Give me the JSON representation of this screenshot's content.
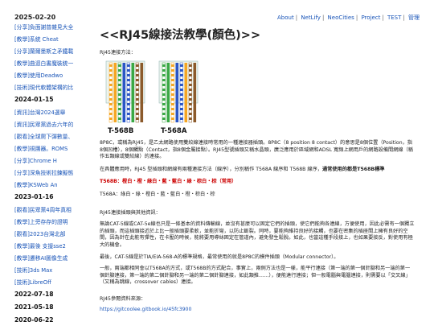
{
  "header": {
    "date": "2025-02-20",
    "nav": [
      "About",
      "NetLify",
      "NeoCities",
      "Project",
      "TEST",
      "管理"
    ]
  },
  "sidebar": {
    "items": [
      {
        "kind": "link",
        "text": "[分享]負面謝普雜見大全"
      },
      {
        "kind": "link",
        "text": "[教學]系統 Cheat"
      },
      {
        "kind": "link",
        "text": "[分享]蘭爾墨斯之矛鐵載"
      },
      {
        "kind": "link",
        "text": "[教學]曲迴白書魔裝統一"
      },
      {
        "kind": "link",
        "text": "[教學]使用Deadwo"
      },
      {
        "kind": "link",
        "text": "[技術]現代軟體架構的比"
      },
      {
        "kind": "date",
        "text": "2024-01-15"
      },
      {
        "kind": "link",
        "text": "[資訊]台灣2024選舉"
      },
      {
        "kind": "link",
        "text": "[資訊]民眾黨過去六年的"
      },
      {
        "kind": "link",
        "text": "[觀看]全球爬下彈數量、"
      },
      {
        "kind": "link",
        "text": "[教學]視團器。ROMS"
      },
      {
        "kind": "link",
        "text": "[分享]Chrome H"
      },
      {
        "kind": "link",
        "text": "[分享]深魚技術拉鍊擬態"
      },
      {
        "kind": "link",
        "text": "[教學]KSWeb An"
      },
      {
        "kind": "date",
        "text": "2023-01-16"
      },
      {
        "kind": "link",
        "text": "[觀看]民眾黨4周年真相"
      },
      {
        "kind": "link",
        "text": "[教學]上旁存存的證明"
      },
      {
        "kind": "link",
        "text": "[觀看]2023台灣北部"
      },
      {
        "kind": "link",
        "text": "[教學]最後 支援sse2"
      },
      {
        "kind": "link",
        "text": "[教學]遷移AI圖像生成"
      },
      {
        "kind": "link",
        "text": "[技術]3ds Max"
      },
      {
        "kind": "link",
        "text": "[技術]LibreOff"
      },
      {
        "kind": "date",
        "text": "2022-07-18"
      },
      {
        "kind": "date",
        "text": "2021-05-18"
      },
      {
        "kind": "date",
        "text": "2020-06-22"
      }
    ]
  },
  "article": {
    "title": "<<RJ45線接法教學(顏色)>>",
    "intro": "RJ45連接方法：",
    "figure_labels": [
      "T-568B",
      "T-568A"
    ],
    "para1": "8P8C，或稱為RJ45，是乙太網路使用雙絞線連接時常用的一種連接器插頭。8P8C（8 position 8 contact）的意思是8個位置（Position，指8個凹槽），8個觸點（Contact，指8個金屬接點）。RJ45型號插頭又稱水晶頭，廣泛應用於區域網和ADSL 寬頻上網用戶的網路設備間網線（稱作五類線或雙絞線）的連接。",
    "para2_a": "在具體應用時，RJ45 型插頭和網線有兩種連接方法（線序），分別稱作 T568A 線序和 T568B 線序，",
    "para2_b": "通常使用的都是T568B標準",
    "t568b_label": "T568B",
    "t568b_text": "：橙白・橙・綠白・藍・藍白・綠・棕白・棕（常用）",
    "t568a_text": "T568A：綠白・綠・橙白・藍・藍白・橙・棕白・棕",
    "section_title": "RJ45連接插頭與其他資訊：",
    "para3": "無論CAT-5線或CAT-5e線也只是一條基本的資料傳輸線，並沒有甚麼可以固定它們的插頭，使它們能夠各連線，方便使用，因此必需有一個獨立的插頭，而這插頭接近於上比一般插頭要柔軟，並能折彎，以防止斷裂。同時，要能夠維持良好的接觸，也要在密集的插座間上擁有良好的空間，因為針在此能有彈性，在卡壓的時候，能將要用導絲固定在管道內，避免發生鬆脫。如此，也當這種手段接上，也如果要接反，對使用有極大的機會。",
    "para4": "最後，CAT-5線是於TIA/EIA-568-A的標準規格，最常使用的就是8P8C的模件插頭（Modular connector）。",
    "para5": "一般，兩端都相同會以T568A的方式，或T568B的方式配合，事實上，兩側方法也是一樣，能平行連接（第一端的第一個針腳和另一端的第一個針腳連接，第一端的第二個針腳和另一端的第二個針腳連接，如此類推……），便能達行連接；但一般電腦與電腦連接，則需要以「交叉線」（又稱為跳線，crossover cables）連接。",
    "refs_title": "RJ45參閱資料來源：",
    "ref_url": "https://gitcoolee.gitbook.io/45fc3900"
  },
  "colors": {
    "link": "#1a55b8",
    "red": "#cc0000"
  }
}
